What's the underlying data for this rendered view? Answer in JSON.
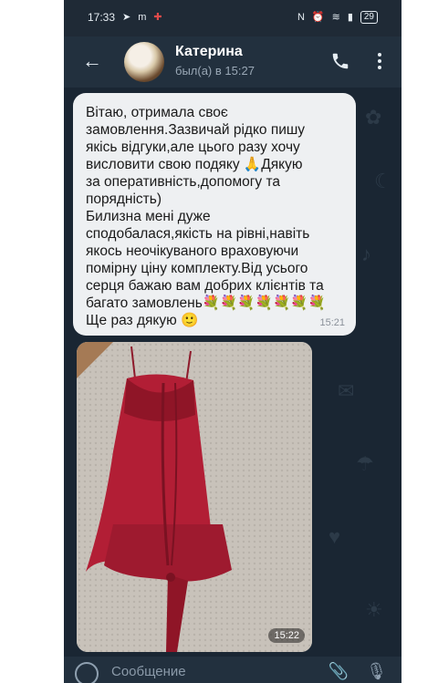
{
  "status_bar": {
    "time": "17:33",
    "left_icons": [
      "location-icon",
      "m-icon",
      "puzzle-icon"
    ],
    "battery": "29"
  },
  "header": {
    "back_icon": "arrow-left-icon",
    "contact_name": "Катерина",
    "last_seen": "был(а) в 15:27",
    "call_icon": "phone-icon",
    "more_icon": "more-vert-icon"
  },
  "message": {
    "text": "Вітаю, отримала своє\nзамовлення.Зазвичай рідко пишу\nякісь відгуки,але цього разу хочу\nвисловити свою подяку 🙏Дякую\nза оперативність,допомогу та\nпорядність)\nБилизна мені дуже\nсподобалася,якість на рівні,навіть\nякось неочікуваного враховуючи\nпомірну ціну комплекту.Від усього\nсерця бажаю вам добрих клієнтів та\nбагато замовлень💐💐💐💐💐💐💐\nЩе раз дякую 🙂",
    "time": "15:21"
  },
  "photo_message": {
    "time": "15:22"
  },
  "input_bar": {
    "placeholder": "Сообщение"
  },
  "colors": {
    "chat_bg": "#1a2633",
    "header_bg": "#22303e",
    "bubble_bg": "#eef0f2",
    "garment": "#b21e35"
  }
}
